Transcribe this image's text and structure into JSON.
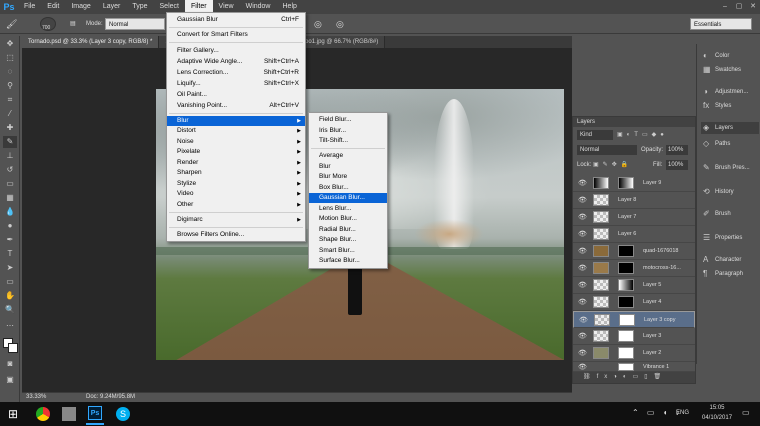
{
  "app": {
    "logo": "Ps"
  },
  "menu": [
    "File",
    "Edit",
    "Image",
    "Layer",
    "Type",
    "Select",
    "Filter",
    "View",
    "Window",
    "Help"
  ],
  "window_controls": [
    "–",
    "▢",
    "✕"
  ],
  "options": {
    "size": "700",
    "mode_label": "Mode:",
    "mode": "Normal",
    "workspace": "Essentials"
  },
  "tabs": [
    "Tornado.psd @ 33.3% (Layer 3 copy, RGB/8) *",
    "...",
    "...lpa-blog-campo1.jpg @ 66.7% (RGB/8#)"
  ],
  "filter_menu": {
    "items": [
      {
        "label": "Gaussian Blur",
        "shortcut": "Ctrl+F"
      },
      {
        "label": "Convert for Smart Filters",
        "shortcut": ""
      },
      {
        "label": "Filter Gallery...",
        "shortcut": ""
      },
      {
        "label": "Adaptive Wide Angle...",
        "shortcut": "Shift+Ctrl+A"
      },
      {
        "label": "Lens Correction...",
        "shortcut": "Shift+Ctrl+R"
      },
      {
        "label": "Liquify...",
        "shortcut": "Shift+Ctrl+X"
      },
      {
        "label": "Oil Paint...",
        "shortcut": ""
      },
      {
        "label": "Vanishing Point...",
        "shortcut": "Alt+Ctrl+V"
      },
      {
        "label": "Blur",
        "shortcut": ""
      },
      {
        "label": "Distort",
        "shortcut": ""
      },
      {
        "label": "Noise",
        "shortcut": ""
      },
      {
        "label": "Pixelate",
        "shortcut": ""
      },
      {
        "label": "Render",
        "shortcut": ""
      },
      {
        "label": "Sharpen",
        "shortcut": ""
      },
      {
        "label": "Stylize",
        "shortcut": ""
      },
      {
        "label": "Video",
        "shortcut": ""
      },
      {
        "label": "Other",
        "shortcut": ""
      },
      {
        "label": "Digimarc",
        "shortcut": ""
      },
      {
        "label": "Browse Filters Online...",
        "shortcut": ""
      }
    ]
  },
  "blur_submenu": [
    "Field Blur...",
    "Iris Blur...",
    "Tilt-Shift...",
    "Average",
    "Blur",
    "Blur More",
    "Box Blur...",
    "Gaussian Blur...",
    "Lens Blur...",
    "Motion Blur...",
    "Radial Blur...",
    "Shape Blur...",
    "Smart Blur...",
    "Surface Blur..."
  ],
  "panels": [
    "Color",
    "Swatches",
    "Adjustmen...",
    "Styles",
    "Layers",
    "Paths",
    "Brush Pres...",
    "History",
    "Brush",
    "Properties",
    "Character",
    "Paragraph"
  ],
  "layers": {
    "title": "Layers",
    "kind": "Kind",
    "blend": "Normal",
    "opacity_label": "Opacity:",
    "opacity": "100%",
    "lock_label": "Lock:",
    "fill_label": "Fill:",
    "fill": "100%",
    "rows": [
      "Layer 9",
      "Layer 8",
      "Layer 7",
      "Layer 6",
      "quad-1676018",
      "motocross-16...",
      "Layer 5",
      "Layer 4",
      "Layer 3 copy",
      "Layer 3",
      "Layer 2",
      "Vibrance 1"
    ]
  },
  "status": {
    "zoom": "33.33%",
    "doc": "Doc: 9.24M/95.8M"
  },
  "taskbar": {
    "lang": "ENG",
    "time": "15:05",
    "date": "04/10/2017"
  }
}
